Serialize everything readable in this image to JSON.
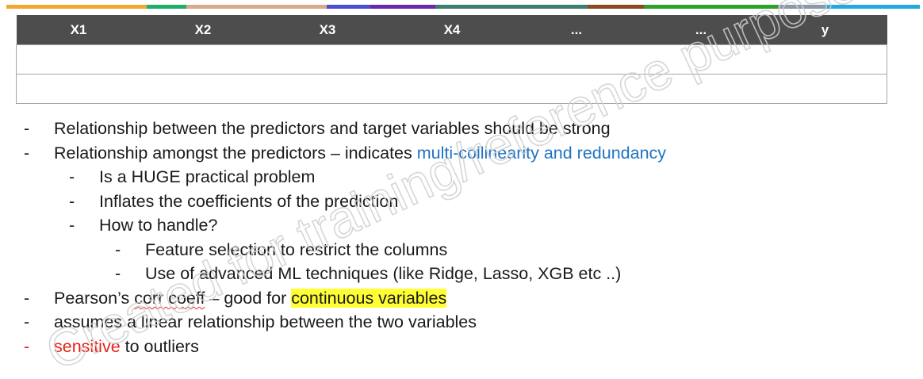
{
  "top_bar_colors": [
    "#f0a830",
    "#1fae6a",
    "#d9a98c",
    "#4a4fcf",
    "#6a2aa8",
    "#3b7d6e",
    "#8a4a22",
    "#2ea12a",
    "#8a99a8",
    "#25a8e0"
  ],
  "table": {
    "headers": [
      "X1",
      "X2",
      "X3",
      "X4",
      "...",
      "...",
      "y"
    ],
    "empty_rows": 2
  },
  "bullets": [
    {
      "level": 1,
      "text": "Relationship between the predictors and target variables should be strong"
    },
    {
      "level": 1,
      "prefix": "Relationship amongst the predictors – indicates ",
      "blue": "multi-collinearity and redundancy"
    },
    {
      "level": 2,
      "text": "Is a HUGE practical problem"
    },
    {
      "level": 2,
      "text": "Inflates the coefficients of the prediction"
    },
    {
      "level": 2,
      "text": "How to handle?"
    },
    {
      "level": 3,
      "text": "Feature selection to restrict the columns"
    },
    {
      "level": 3,
      "text": "Use of advanced ML techniques (like Ridge, Lasso, XGB etc ..)"
    },
    {
      "level": 1,
      "prefix": "Pearson’s ",
      "underlined": "corr coeff",
      "middle": " – good for ",
      "highlight": "continuous variables"
    },
    {
      "level": 1,
      "text": "assumes a linear relationship between the two variables"
    },
    {
      "level": 1,
      "red": "sensitive",
      "suffix": " to outliers"
    }
  ],
  "dash": "-",
  "watermark": "Created for training/reference purposes"
}
